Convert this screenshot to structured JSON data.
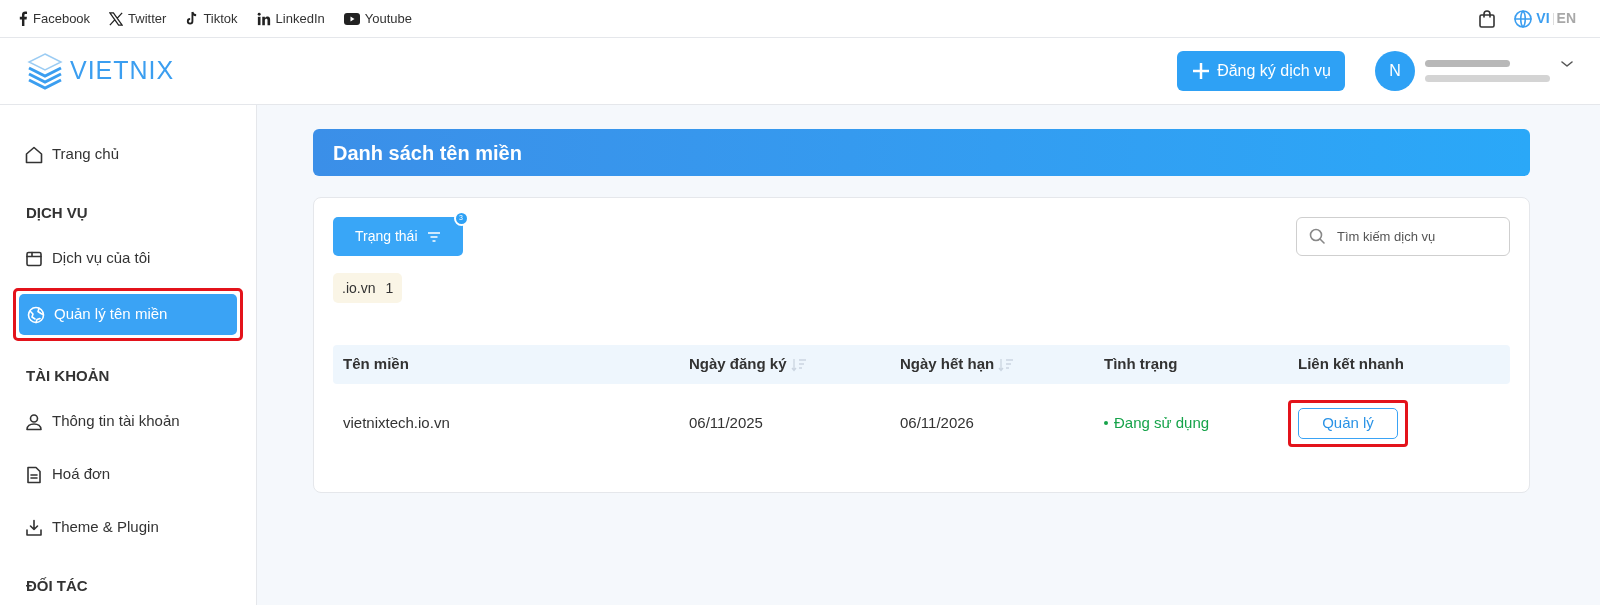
{
  "social_links": [
    {
      "kind": "facebook",
      "label": "Facebook"
    },
    {
      "kind": "twitter",
      "label": "Twitter"
    },
    {
      "kind": "tiktok",
      "label": "Tiktok"
    },
    {
      "kind": "linkedin",
      "label": "LinkedIn"
    },
    {
      "kind": "youtube",
      "label": "Youtube"
    }
  ],
  "languages": [
    {
      "label": "VI",
      "selected": true
    },
    {
      "label": "EN",
      "selected": false
    }
  ],
  "header": {
    "logo": "VIETNIX",
    "register_button": "Đăng ký dịch vụ",
    "avatar": "N"
  },
  "sidebar": [
    {
      "kind": "home",
      "label": "Trang chủ",
      "selected": false,
      "highlighted": false
    },
    {
      "kind": "section",
      "label": "DỊCH VỤ"
    },
    {
      "kind": "services",
      "label": "Dịch vụ của tôi",
      "selected": false,
      "highlighted": false
    },
    {
      "kind": "domains",
      "label": "Quản lý tên miền",
      "selected": true,
      "highlighted": true
    },
    {
      "kind": "section",
      "label": "TÀI KHOẢN"
    },
    {
      "kind": "account",
      "label": "Thông tin tài khoản",
      "selected": false,
      "highlighted": false
    },
    {
      "kind": "invoices",
      "label": "Hoá đơn",
      "selected": false,
      "highlighted": false
    },
    {
      "kind": "downloads",
      "label": "Theme & Plugin",
      "selected": false,
      "highlighted": false
    },
    {
      "kind": "section",
      "label": "ĐỐI TÁC"
    }
  ],
  "page_title": "Danh sách tên miền",
  "filter_button": {
    "label": "Trạng thái",
    "badge": "3"
  },
  "search": {
    "placeholder": "Tìm kiếm dịch vụ"
  },
  "tags": [
    {
      "label": ".io.vn",
      "count": "1"
    }
  ],
  "table": {
    "columns": [
      {
        "label": "Tên miền",
        "sortable": false
      },
      {
        "label": "Ngày đăng ký",
        "sortable": true
      },
      {
        "label": "Ngày hết hạn",
        "sortable": true
      },
      {
        "label": "Tình trạng",
        "sortable": false
      },
      {
        "label": "Liên kết nhanh",
        "sortable": false
      }
    ],
    "rows": [
      {
        "domain": "vietnixtech.io.vn",
        "registered": "06/11/2025",
        "expires": "06/11/2026",
        "status": "Đang sử dụng",
        "kind": "active",
        "action": "Quản lý",
        "action_highlighted": true
      }
    ]
  }
}
